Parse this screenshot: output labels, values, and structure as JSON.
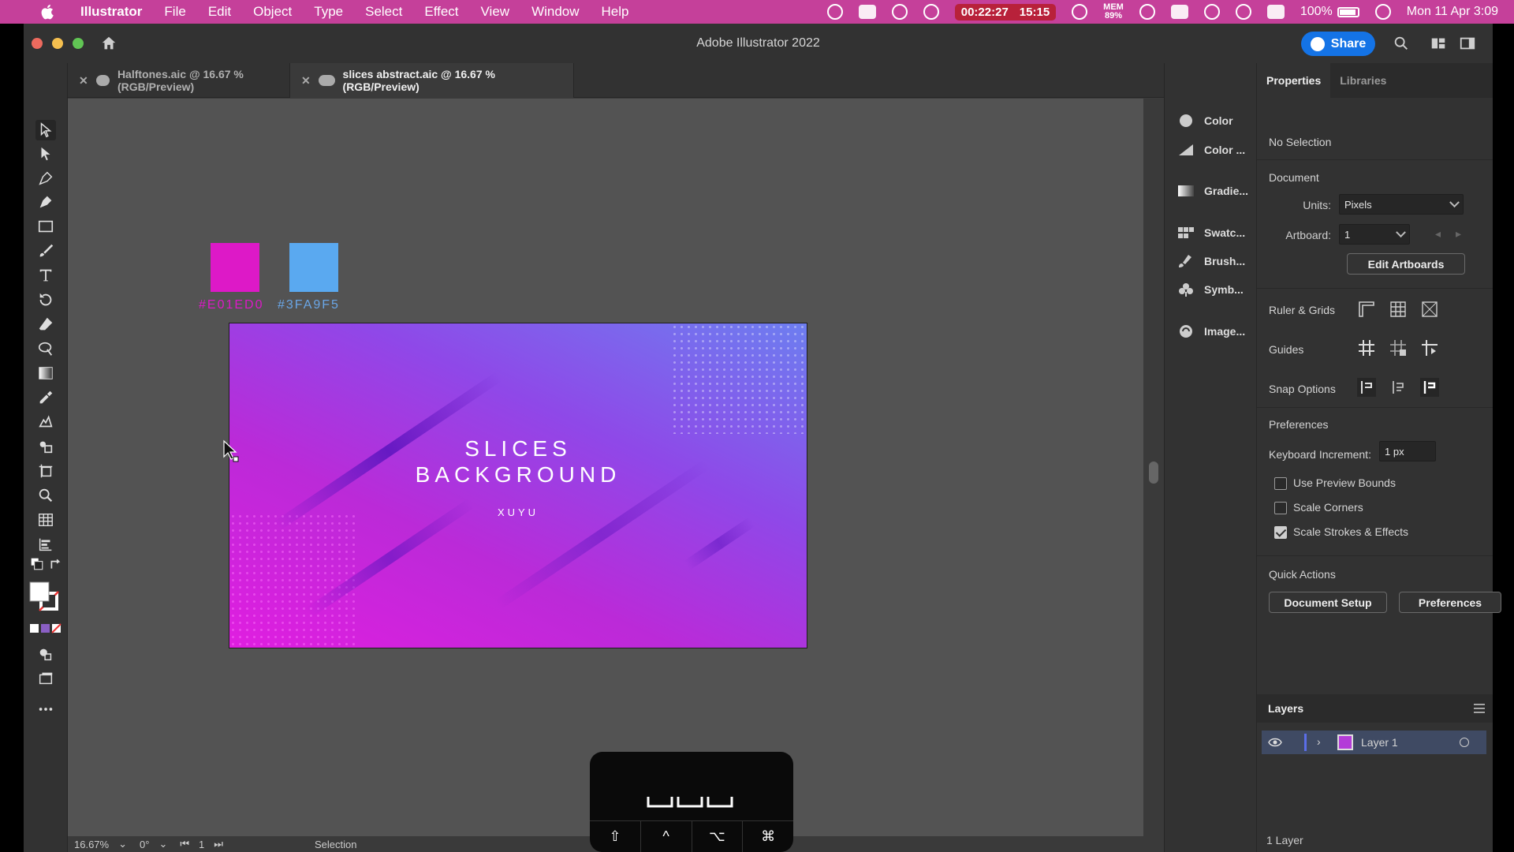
{
  "menubar": {
    "app_name": "Illustrator",
    "items": [
      "File",
      "Edit",
      "Object",
      "Type",
      "Select",
      "Effect",
      "View",
      "Window",
      "Help"
    ],
    "timer": "00:22:27",
    "timer_total": "15:15",
    "mem_label": "MEM",
    "mem_value": "89%",
    "battery": "100%",
    "datetime": "Mon 11 Apr  3:09"
  },
  "window": {
    "title": "Adobe Illustrator 2022",
    "share_label": "Share"
  },
  "tabs": [
    {
      "label": "Halftones.aic @ 16.67 % (RGB/Preview)",
      "active": false
    },
    {
      "label": "slices abstract.aic @ 16.67 % (RGB/Preview)",
      "active": true
    }
  ],
  "canvas": {
    "swatches": [
      {
        "hex_label": "#E01ED0",
        "color": "#dd19c7"
      },
      {
        "hex_label": "#3FA9F5",
        "color": "#5aa9f0"
      }
    ],
    "artboard": {
      "title_line1": "SLICES",
      "title_line2": "BACKGROUND",
      "subtitle": "XUYU"
    }
  },
  "statusbar": {
    "zoom": "16.67%",
    "rotation": "0°",
    "artboard_num": "1",
    "mode": "Selection"
  },
  "panel_strip": [
    {
      "label": "Color",
      "icon": "color-icon"
    },
    {
      "label": "Color ...",
      "icon": "color-guide-icon"
    },
    {
      "label": "Gradie...",
      "icon": "gradient-icon"
    },
    {
      "label": "Swatc...",
      "icon": "swatches-icon"
    },
    {
      "label": "Brush...",
      "icon": "brushes-icon"
    },
    {
      "label": "Symb...",
      "icon": "symbols-icon"
    },
    {
      "label": "Image...",
      "icon": "image-trace-icon"
    }
  ],
  "properties": {
    "tab_properties": "Properties",
    "tab_libraries": "Libraries",
    "selection": "No Selection",
    "document_heading": "Document",
    "units_label": "Units:",
    "units_value": "Pixels",
    "artboard_label": "Artboard:",
    "artboard_value": "1",
    "edit_artboards": "Edit Artboards",
    "ruler_grids": "Ruler & Grids",
    "guides": "Guides",
    "snap_options": "Snap Options",
    "preferences_heading": "Preferences",
    "keyboard_increment_label": "Keyboard Increment:",
    "keyboard_increment_value": "1 px",
    "use_preview_bounds": "Use Preview Bounds",
    "scale_corners": "Scale Corners",
    "scale_strokes": "Scale Strokes & Effects",
    "quick_actions": "Quick Actions",
    "document_setup": "Document Setup",
    "preferences_btn": "Preferences"
  },
  "checkboxes": {
    "use_preview_bounds": false,
    "scale_corners": false,
    "scale_strokes": true
  },
  "layers": {
    "title": "Layers",
    "layer_name": "Layer 1",
    "count": "1 Layer"
  },
  "touchbar": {
    "keys": [
      "⇧",
      "^",
      "⌥",
      "⌘"
    ]
  },
  "colors": {
    "accent": "#1473e6",
    "menubar": "#c5409a"
  }
}
